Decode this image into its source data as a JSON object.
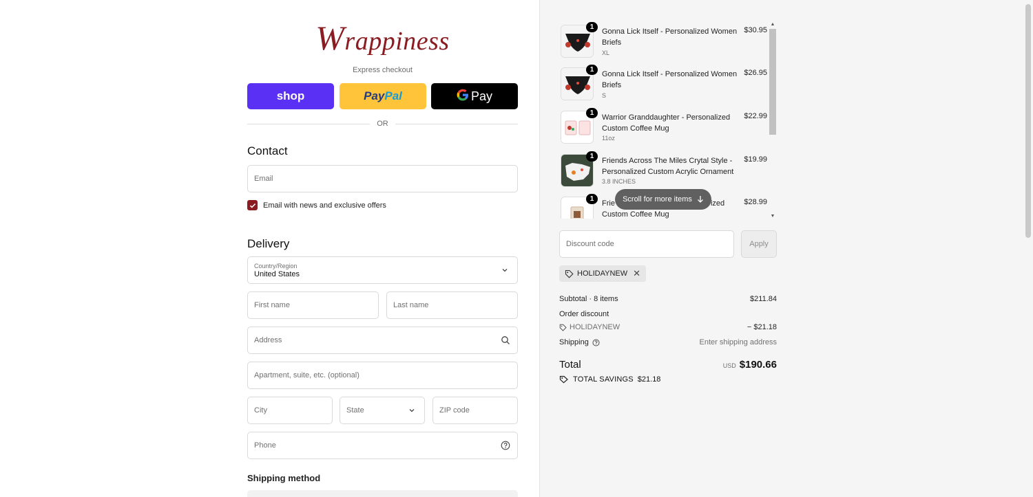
{
  "brand": {
    "logo_text": "Wrappiness"
  },
  "express": {
    "label": "Express checkout",
    "shop_label": "shop",
    "paypal_label_a": "Pay",
    "paypal_label_b": "Pal",
    "gpay_label": "Pay",
    "or_label": "OR"
  },
  "contact": {
    "heading": "Contact",
    "email_placeholder": "Email",
    "newsletter_label": "Email with news and exclusive offers",
    "newsletter_checked": true
  },
  "delivery": {
    "heading": "Delivery",
    "country_caption": "Country/Region",
    "country_value": "United States",
    "first_name_placeholder": "First name",
    "last_name_placeholder": "Last name",
    "address_placeholder": "Address",
    "apartment_placeholder": "Apartment, suite, etc. (optional)",
    "city_placeholder": "City",
    "state_placeholder": "State",
    "zip_placeholder": "ZIP code",
    "phone_placeholder": "Phone",
    "shipping_method_heading": "Shipping method"
  },
  "cart": {
    "items": [
      {
        "title": "Gonna Lick Itself - Personalized Women Briefs",
        "variant": "XL",
        "price": "$30.95",
        "qty": "1"
      },
      {
        "title": "Gonna Lick Itself - Personalized Women Briefs",
        "variant": "S",
        "price": "$26.95",
        "qty": "1"
      },
      {
        "title": "Warrior Granddaughter - Personalized Custom Coffee Mug",
        "variant": "11oz",
        "price": "$22.99",
        "qty": "1"
      },
      {
        "title": "Friends Across The Miles Crytal Style - Personalized Custom Acrylic Ornament",
        "variant": "3.8 INCHES",
        "price": "$19.99",
        "qty": "1"
      },
      {
        "title": "Friends ... Personalized Custom Coffee Mug",
        "title_visible_a": "Frie",
        "title_visible_b": "ized",
        "title_line2": "Custom Coffee Mug",
        "variant": "",
        "price": "$28.99",
        "qty": "1"
      }
    ],
    "scroll_hint": "Scroll for more items"
  },
  "discount": {
    "placeholder": "Discount code",
    "apply_label": "Apply",
    "applied_code": "HOLIDAYNEW"
  },
  "summary": {
    "subtotal_label": "Subtotal · 8 items",
    "subtotal_value": "$211.84",
    "order_discount_label": "Order discount",
    "discount_code": "HOLIDAYNEW",
    "discount_value": "− $21.18",
    "shipping_label": "Shipping",
    "shipping_value": "Enter shipping address",
    "total_label": "Total",
    "currency": "USD",
    "total_value": "$190.66",
    "savings_label": "TOTAL SAVINGS",
    "savings_value": "$21.18"
  },
  "colors": {
    "brand": "#8a1c22",
    "shop": "#5a31f4",
    "paypal": "#ffc439",
    "gpay": "#000000"
  }
}
